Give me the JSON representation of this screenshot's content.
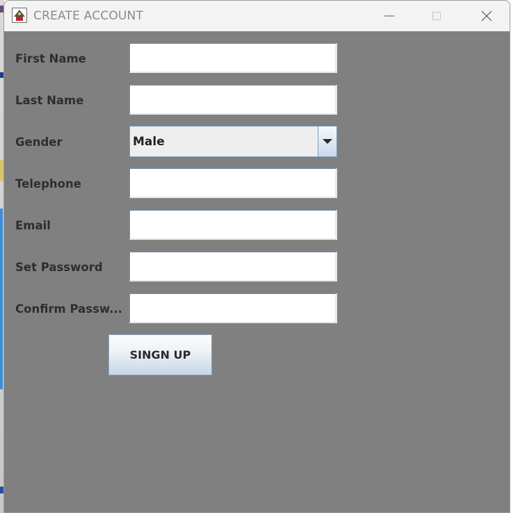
{
  "window": {
    "title": "CREATE ACCOUNT",
    "app_icon": "java-app-icon",
    "controls": [
      "minimize-icon",
      "maximize-icon",
      "close-icon"
    ]
  },
  "form": {
    "fields": [
      {
        "label": "First Name",
        "value": ""
      },
      {
        "label": "Last Name",
        "value": ""
      },
      {
        "label": "Telephone",
        "value": ""
      },
      {
        "label": "Email",
        "value": ""
      },
      {
        "label": "Set Password",
        "value": ""
      },
      {
        "label": "Confirm Passw...",
        "value": ""
      }
    ],
    "gender": {
      "label": "Gender",
      "selected": "Male"
    },
    "submit_label": "SINGN UP"
  },
  "colors": {
    "panel_background": "#808080",
    "titlebar_background": "#f3f3f3",
    "label_text": "#2e2e2e",
    "field_border": "#6e8aa8"
  }
}
